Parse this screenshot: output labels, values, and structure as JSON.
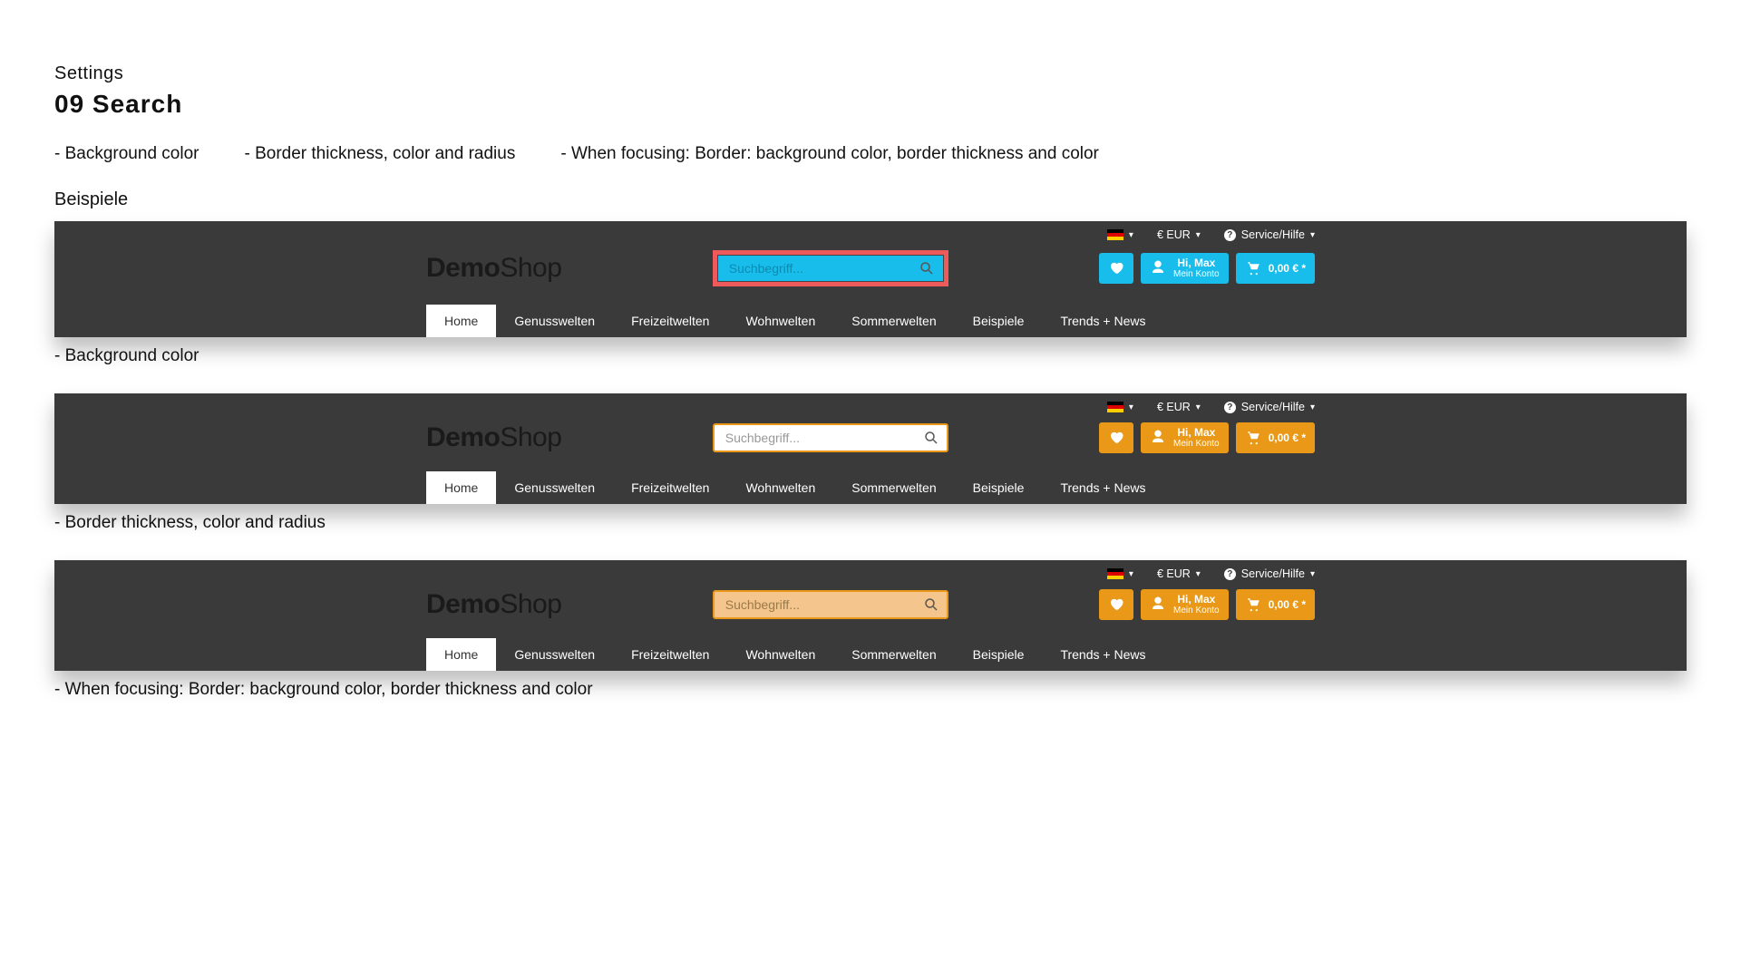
{
  "breadcrumb": "Settings",
  "title": "09 Search",
  "descriptions": {
    "bg": "- Background color",
    "border": "- Border thickness, color and radius",
    "focus": "- When focusing: Border: background color, border thickness and color"
  },
  "examples_label": "Beispiele",
  "shared": {
    "logo_bold": "Demo",
    "logo_light": "Shop",
    "currency": "€ EUR",
    "service": "Service/Hilfe",
    "account_hi": "Hi, Max",
    "account_sub": "Mein Konto",
    "cart_total": "0,00 € *",
    "nav": [
      "Home",
      "Genusswelten",
      "Freizeitwelten",
      "Wohnwelten",
      "Sommerwelten",
      "Beispiele",
      "Trends + News"
    ],
    "active_nav": "Home"
  },
  "variants": [
    {
      "class": "v1",
      "accent": "#18BDEB",
      "search_placeholder": "Suchbegriff..."
    },
    {
      "class": "v2",
      "accent": "#E99817",
      "search_placeholder": "Suchbegriff..."
    },
    {
      "class": "v3",
      "accent": "#E99817",
      "search_placeholder": "Suchbegriff..."
    }
  ],
  "captions": {
    "v1": "- Background color",
    "v2": "- Border thickness, color and radius",
    "v3": "- When focusing: Border: background color, border thickness and color"
  }
}
